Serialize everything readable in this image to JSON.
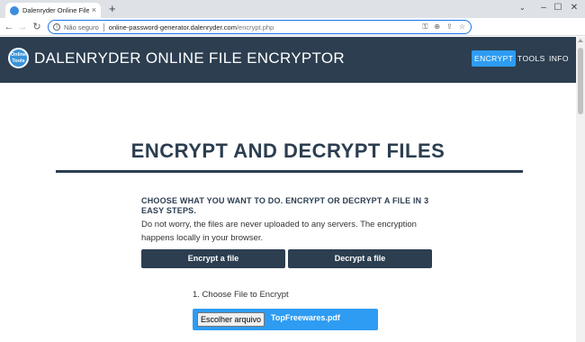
{
  "browser": {
    "tab_title": "Dalenryder Online File Encryptor",
    "tab_close": "×",
    "new_tab": "+",
    "window_controls": {
      "dropdown": "⌄",
      "minimize": "–",
      "maximize": "☐",
      "close": "✕"
    },
    "nav": {
      "back": "←",
      "forward": "→",
      "reload": "↻"
    },
    "address": {
      "security_label": "Não seguro",
      "host": "online-password-generator.dalenryder.com",
      "path": "/encrypt.php"
    },
    "omnibox_icons": [
      "key-icon",
      "zoom-icon",
      "share-icon",
      "star-icon"
    ],
    "accent_color": "#1a73e8"
  },
  "site": {
    "logo_text": "Online Tools",
    "title": "DALENRYDER ONLINE FILE ENCRYPTOR",
    "nav": [
      "ENCRYPT",
      "TOOLS",
      "INFO"
    ],
    "header_color": "#2c3e50",
    "accent_color": "#2e9cf2"
  },
  "main": {
    "heading": "ENCRYPT AND DECRYPT FILES",
    "subheading": "CHOOSE WHAT YOU WANT TO DO. ENCRYPT OR DECRYPT A FILE IN 3 EASY STEPS.",
    "note": "Do not worry, the files are never uploaded to any servers. The encryption happens locally in your browser.",
    "encrypt_button": "Encrypt a file",
    "decrypt_button": "Decrypt a file",
    "step_label": "1. Choose File to Encrypt",
    "file_button": "Escolher arquivo",
    "file_name": "TopFreewares.pdf"
  }
}
